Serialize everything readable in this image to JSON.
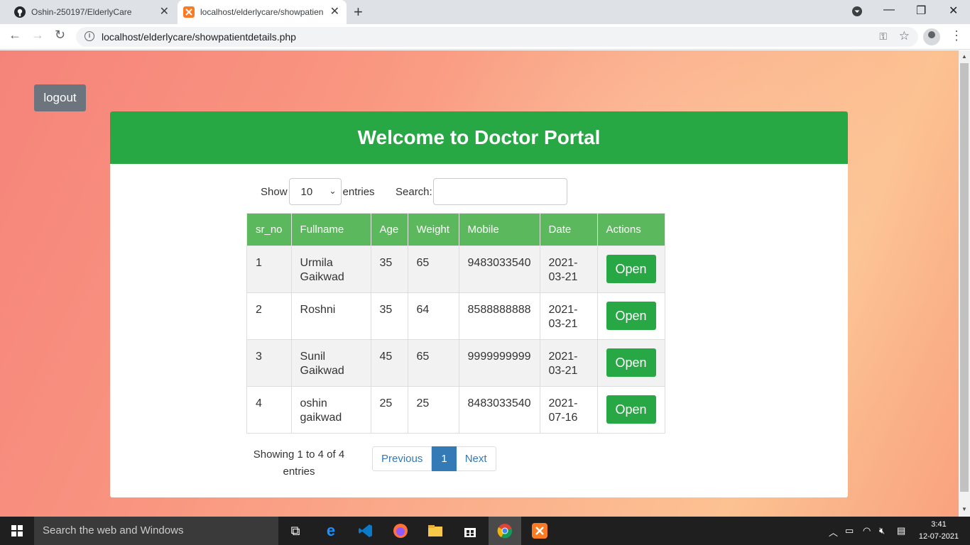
{
  "browser": {
    "tabs": [
      {
        "title": "Oshin-250197/ElderlyCare",
        "icon": "github-icon"
      },
      {
        "title": "localhost/elderlycare/showpatien",
        "icon": "xampp-icon"
      }
    ],
    "url": "localhost/elderlycare/showpatientdetails.php"
  },
  "page": {
    "logout_label": "logout",
    "header_title": "Welcome to Doctor Portal",
    "length": {
      "show_label": "Show",
      "selected": "10",
      "entries_label": "entries"
    },
    "search": {
      "label": "Search:",
      "value": ""
    },
    "table": {
      "columns": [
        "sr_no",
        "Fullname",
        "Age",
        "Weight",
        "Mobile",
        "Date",
        "Actions"
      ],
      "rows": [
        {
          "sr_no": "1",
          "fullname": "Urmila Gaikwad",
          "age": "35",
          "weight": "65",
          "mobile": "9483033540",
          "date": "2021-03-21",
          "action": "Open"
        },
        {
          "sr_no": "2",
          "fullname": "Roshni",
          "age": "35",
          "weight": "64",
          "mobile": "8588888888",
          "date": "2021-03-21",
          "action": "Open"
        },
        {
          "sr_no": "3",
          "fullname": "Sunil Gaikwad",
          "age": "45",
          "weight": "65",
          "mobile": "9999999999",
          "date": "2021-03-21",
          "action": "Open"
        },
        {
          "sr_no": "4",
          "fullname": "oshin gaikwad",
          "age": "25",
          "weight": "25",
          "mobile": "8483033540",
          "date": "2021-07-16",
          "action": "Open"
        }
      ]
    },
    "info": "Showing 1 to 4 of 4 entries",
    "pagination": {
      "previous": "Previous",
      "current": "1",
      "next": "Next"
    },
    "colors": {
      "header_green": "#28a745",
      "table_header_green": "#5cb85c",
      "logout_gray": "#6c757d",
      "pager_blue": "#337ab7"
    }
  },
  "taskbar": {
    "search_placeholder": "Search the web and Windows",
    "time": "3:41",
    "date": "12-07-2021"
  }
}
